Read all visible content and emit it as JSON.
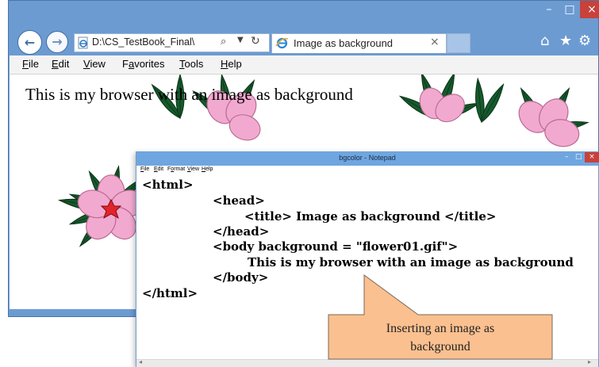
{
  "browser": {
    "window_controls": {
      "minimize": "–",
      "maximize": "□",
      "close": "×"
    },
    "address": "D:\\CS_TestBook_Final\\",
    "tab_title": "Image as background",
    "tab_close": "×",
    "toolbar_icons": [
      "home-icon",
      "favorites-star-icon",
      "settings-gear-icon"
    ],
    "menu": [
      {
        "underline": "F",
        "rest": "ile"
      },
      {
        "underline": "E",
        "rest": "dit"
      },
      {
        "underline": "V",
        "rest": "iew"
      },
      {
        "underline": "F",
        "rest": "avorites",
        "pre": "F"
      },
      {
        "underline": "T",
        "rest": "ools"
      },
      {
        "underline": "H",
        "rest": "elp"
      }
    ],
    "menu_labels": {
      "file_u": "F",
      "file": "ile",
      "edit_u": "E",
      "edit": "dit",
      "view_u": "V",
      "view": "iew",
      "fav_pre": "F",
      "fav_u": "a",
      "fav": "vorites",
      "tools_u": "T",
      "tools": "ools",
      "help_u": "H",
      "help": "elp"
    },
    "page_text": "This is my browser with an image as background",
    "accent_color": "#6c9bd2"
  },
  "notepad": {
    "title": "bgcolor - Notepad",
    "menu_labels": {
      "file_u": "F",
      "file": "ile",
      "edit_u": "E",
      "edit": "dit",
      "format_pre": "F",
      "format_u": "o",
      "format": "rmat",
      "view_u": "V",
      "view": "iew",
      "help_u": "H",
      "help": "elp"
    },
    "code_lines": [
      "<html>",
      "<head>",
      "<title> Image as background </title>",
      "</head>",
      "<body background = \"flower01.gif\">",
      "This is my browser with an image as background",
      "</body>",
      "</html>"
    ]
  },
  "callout": {
    "line1": "Inserting an image as",
    "line2": "background",
    "fill": "#fbc08f"
  }
}
